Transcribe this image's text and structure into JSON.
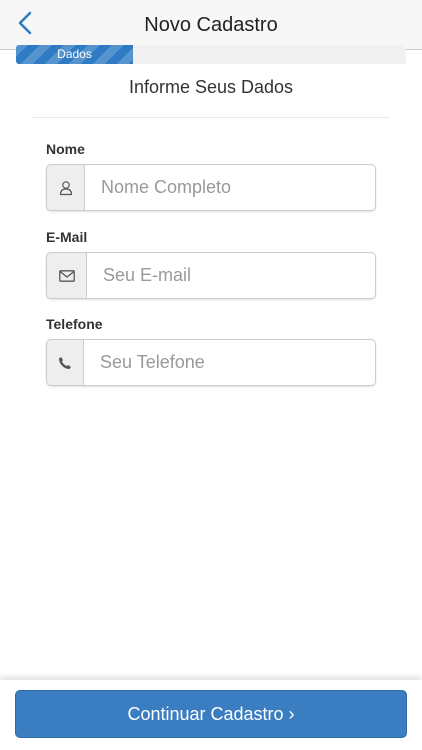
{
  "navbar": {
    "title": "Novo Cadastro",
    "back_icon": "chevron-left-icon",
    "accent_color": "#2f7cc4"
  },
  "progress": {
    "label": "Dados",
    "value_fraction": 0.3
  },
  "form": {
    "heading": "Informe Seus Dados",
    "fields": [
      {
        "label": "Nome",
        "placeholder": "Nome Completo",
        "value": "",
        "icon": "user-icon"
      },
      {
        "label": "E-Mail",
        "placeholder": "Seu E-mail",
        "value": "",
        "icon": "envelope-icon"
      },
      {
        "label": "Telefone",
        "placeholder": "Seu Telefone",
        "value": "",
        "icon": "phone-icon"
      }
    ]
  },
  "footer": {
    "continue_label": "Continuar Cadastro",
    "continue_icon": "chevron-right-icon",
    "button_color": "#3a7ec1"
  }
}
